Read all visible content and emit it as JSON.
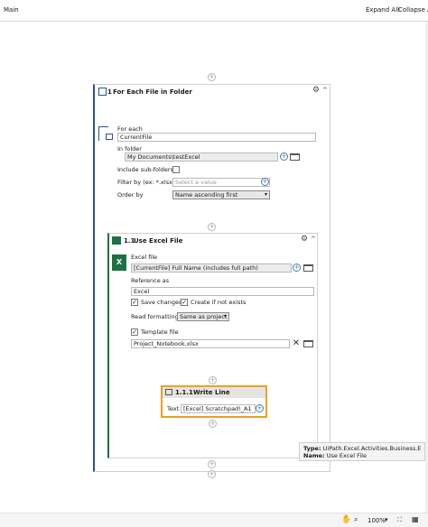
{
  "topbar": {
    "title": "Main",
    "expand_all": "Expand All",
    "collapse_all": "Collapse All"
  },
  "for_each": {
    "number": "1",
    "title": "For Each File in Folder",
    "for_each_label": "For each",
    "for_each_value": "CurrentFile",
    "in_folder_label": "In folder",
    "in_folder_value": "My Documents\\testExcel",
    "include_subfolders_label": "Include sub-folders",
    "filter_label": "Filter by (ex: *.xlsx)",
    "filter_placeholder": "Select a value",
    "order_label": "Order by",
    "order_value": "Name ascending first"
  },
  "use_excel": {
    "number": "1.1",
    "title": "Use Excel File",
    "excel_file_label": "Excel file",
    "excel_file_value": "[CurrentFile] Full Name (includes full path)",
    "reference_label": "Reference as",
    "reference_value": "Excel",
    "save_changes_label": "Save changes",
    "create_if_not_exists_label": "Create if not exists",
    "read_formatting_label": "Read formatting",
    "read_formatting_value": "Same as project",
    "template_file_label": "Template file",
    "template_file_value": "Project_Notebook.xlsx"
  },
  "write_line": {
    "number": "1.1.1",
    "title": "Write Line",
    "text_label": "Text",
    "text_value": "[Excel] Scratchpad!_A1"
  },
  "tooltip": {
    "type_label": "Type:",
    "type_value": "UiPath.Excel.Activities.Business.ExcelApplicationCard",
    "name_label": "Name:",
    "name_value": "Use Excel File"
  },
  "statusbar": {
    "zoom": "100%"
  },
  "colors": {
    "accent_blue": "#2b4f9b",
    "highlight_orange": "#f0a020",
    "excel_green": "#1e7145"
  }
}
